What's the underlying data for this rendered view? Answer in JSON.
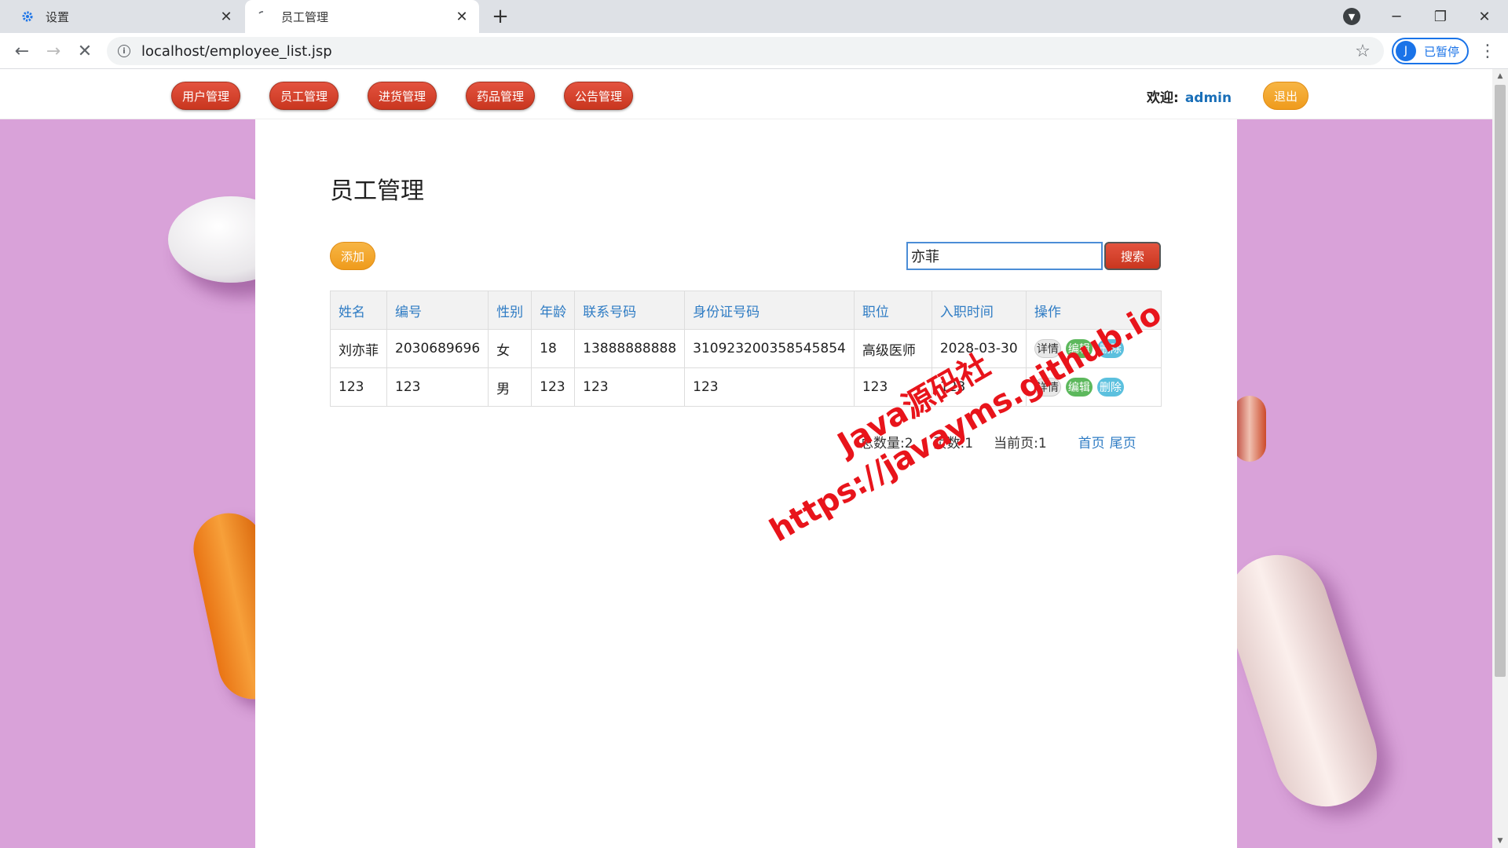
{
  "browser": {
    "tabs": [
      {
        "label": "设置",
        "icon": "gear-icon"
      },
      {
        "label": "员工管理",
        "icon": "loading-icon"
      }
    ],
    "url": "localhost/employee_list.jsp",
    "profile_initial": "J",
    "profile_label": "已暂停"
  },
  "nav": {
    "items": [
      "用户管理",
      "员工管理",
      "进货管理",
      "药品管理",
      "公告管理"
    ],
    "welcome_label": "欢迎:",
    "username": "admin",
    "logout_label": "退出"
  },
  "page": {
    "title": "员工管理",
    "add_label": "添加",
    "search_value": "亦菲",
    "search_label": "搜索"
  },
  "table": {
    "headers": [
      "姓名",
      "编号",
      "性别",
      "年龄",
      "联系号码",
      "身份证号码",
      "职位",
      "入职时间",
      "操作"
    ],
    "rows": [
      [
        "刘亦菲",
        "2030689696",
        "女",
        "18",
        "13888888888",
        "310923200358545854",
        "高级医师",
        "2028-03-30"
      ],
      [
        "123",
        "123",
        "男",
        "123",
        "123",
        "123",
        "123",
        "123"
      ]
    ],
    "actions": {
      "detail": "详情",
      "edit": "编辑",
      "delete": "删除"
    }
  },
  "pager": {
    "total": "总数量:2",
    "pages": "页数:1",
    "current": "当前页:1",
    "first": "首页",
    "last": "尾页"
  },
  "watermark": {
    "line1": "Java源码社",
    "line2": "https://javayms.github.io"
  },
  "colors": {
    "nav_button": "#d9442e",
    "accent_orange": "#f2a52c",
    "header_text": "#2f7cc4",
    "watermark": "#e8141b"
  }
}
